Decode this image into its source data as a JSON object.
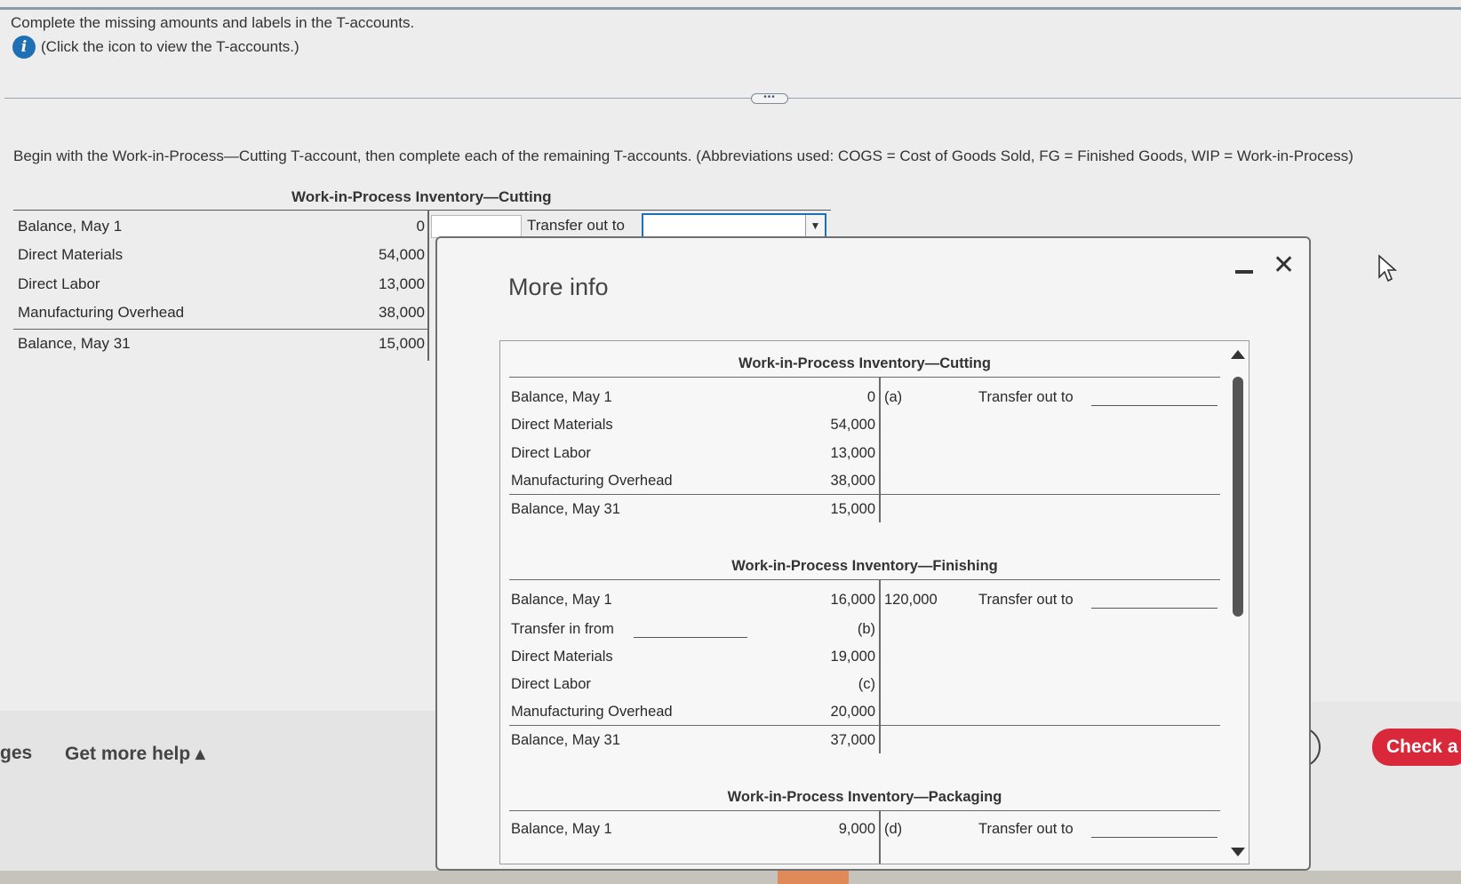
{
  "instructions": {
    "line1": "Complete the missing amounts and labels in the T-accounts.",
    "line2": "(Click the icon to view the T-accounts.)",
    "begin": "Begin with the Work-in-Process—Cutting T-account, then complete each of the remaining T-accounts. (Abbreviations used: COGS = Cost of Goods Sold, FG = Finished Goods, WIP = Work-in-Process)"
  },
  "left_account": {
    "title": "Work-in-Process Inventory—Cutting",
    "rows": [
      {
        "label": "Balance, May 1",
        "amount": "0"
      },
      {
        "label": "Direct Materials",
        "amount": "54,000"
      },
      {
        "label": "Direct Labor",
        "amount": "13,000"
      },
      {
        "label": "Manufacturing Overhead",
        "amount": "38,000"
      },
      {
        "label": "Balance, May 31",
        "amount": "15,000"
      }
    ],
    "transfer_label": "Transfer out to",
    "transfer_input_value": "",
    "transfer_select_value": ""
  },
  "footer": {
    "ges": "ges",
    "help": "Get more help ▴",
    "check": "Check a"
  },
  "modal": {
    "title": "More info",
    "accounts": [
      {
        "title": "Work-in-Process Inventory—Cutting",
        "rows": [
          {
            "label": "Balance, May 1",
            "amount": "0",
            "credit": "(a)",
            "credit_label": "Transfer out to"
          },
          {
            "label": "Direct Materials",
            "amount": "54,000",
            "credit": "",
            "credit_label": ""
          },
          {
            "label": "Direct Labor",
            "amount": "13,000",
            "credit": "",
            "credit_label": ""
          },
          {
            "label": "Manufacturing Overhead",
            "amount": "38,000",
            "credit": "",
            "credit_label": ""
          },
          {
            "label": "Balance, May 31",
            "amount": "15,000",
            "credit": "",
            "credit_label": ""
          }
        ]
      },
      {
        "title": "Work-in-Process Inventory—Finishing",
        "rows": [
          {
            "label": "Balance, May 1",
            "amount": "16,000",
            "credit": "120,000",
            "credit_label": "Transfer out to"
          },
          {
            "label": "Transfer in from",
            "amount": "(b)",
            "credit": "",
            "credit_label": ""
          },
          {
            "label": "Direct Materials",
            "amount": "19,000",
            "credit": "",
            "credit_label": ""
          },
          {
            "label": "Direct Labor",
            "amount": "(c)",
            "credit": "",
            "credit_label": ""
          },
          {
            "label": "Manufacturing Overhead",
            "amount": "20,000",
            "credit": "",
            "credit_label": ""
          },
          {
            "label": "Balance, May 31",
            "amount": "37,000",
            "credit": "",
            "credit_label": ""
          }
        ]
      },
      {
        "title": "Work-in-Process Inventory—Packaging",
        "rows": [
          {
            "label": "Balance, May 1",
            "amount": "9,000",
            "credit": "(d)",
            "credit_label": "Transfer out to"
          }
        ]
      }
    ]
  },
  "icons": [
    "info-icon",
    "minimize-icon",
    "close-icon",
    "cursor-icon",
    "chevron-down-icon"
  ],
  "colors": {
    "accent": "#1f6fb5",
    "check": "#d9283a"
  }
}
